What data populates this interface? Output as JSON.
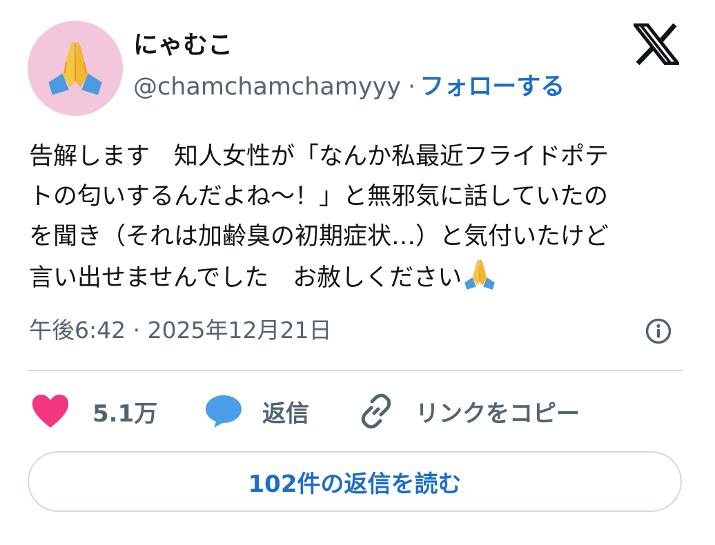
{
  "user": {
    "display_name": "にゃむこ",
    "handle": "@chamchamchamyyy",
    "separator": "·",
    "follow_label": "フォローする",
    "avatar_icon": "folded-hands-emoji",
    "avatar_bg": "#f4c6dc"
  },
  "tweet": {
    "lines": [
      "告解します　知人女性が「なんか私最近フライドポテ",
      "トの匂いするんだよね〜！」と無邪気に話していたの",
      "を聞き（それは加齢臭の初期症状…）と気付いたけど",
      "言い出せませんでした　お赦しください"
    ],
    "trailing_emoji": "folded-hands-emoji",
    "timestamp": "午後6:42 · 2025年12月21日"
  },
  "actions": {
    "like_count": "5.1万",
    "reply_label": "返信",
    "copy_link_label": "リンクをコピー"
  },
  "read_replies_label": "102件の返信を読む",
  "colors": {
    "like": "#f0377f",
    "reply": "#4a9fe8",
    "link_blue": "#1d6ec7",
    "muted": "#536471"
  }
}
